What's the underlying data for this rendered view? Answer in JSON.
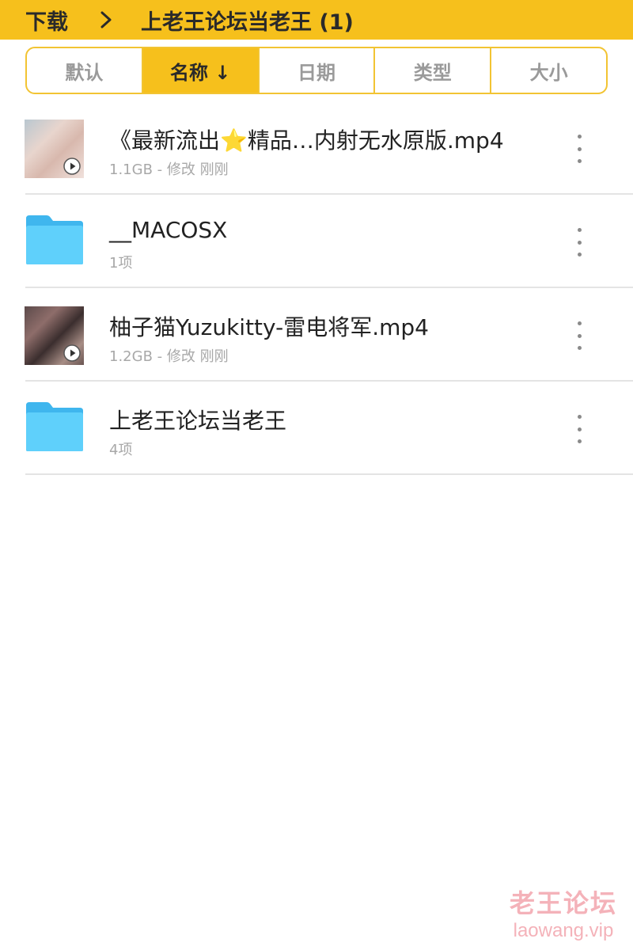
{
  "header": {
    "root": "下载",
    "current": "上老王论坛当老王 (1)"
  },
  "sort_tabs": [
    {
      "label": "默认",
      "active": false
    },
    {
      "label": "名称 ↓",
      "active": true
    },
    {
      "label": "日期",
      "active": false
    },
    {
      "label": "类型",
      "active": false
    },
    {
      "label": "大小",
      "active": false
    }
  ],
  "files": [
    {
      "type": "video",
      "thumb_icon": "video-thumbnail",
      "name": "《最新流出⭐精品…内射无水原版.mp4",
      "meta": "1.1GB - 修改 刚刚"
    },
    {
      "type": "folder",
      "thumb_icon": "folder-icon",
      "name": "__MACOSX",
      "meta": "1项"
    },
    {
      "type": "video",
      "thumb_icon": "video-thumbnail",
      "name": "柚子猫Yuzukitty-雷电将军.mp4",
      "meta": "1.2GB - 修改 刚刚"
    },
    {
      "type": "folder",
      "thumb_icon": "folder-icon",
      "name": "上老王论坛当老王",
      "meta": "4项"
    }
  ],
  "watermark": {
    "cn": "老王论坛",
    "en": "laowang.vip"
  },
  "colors": {
    "accent": "#f6c01c",
    "folder": "#4fc3f7"
  }
}
